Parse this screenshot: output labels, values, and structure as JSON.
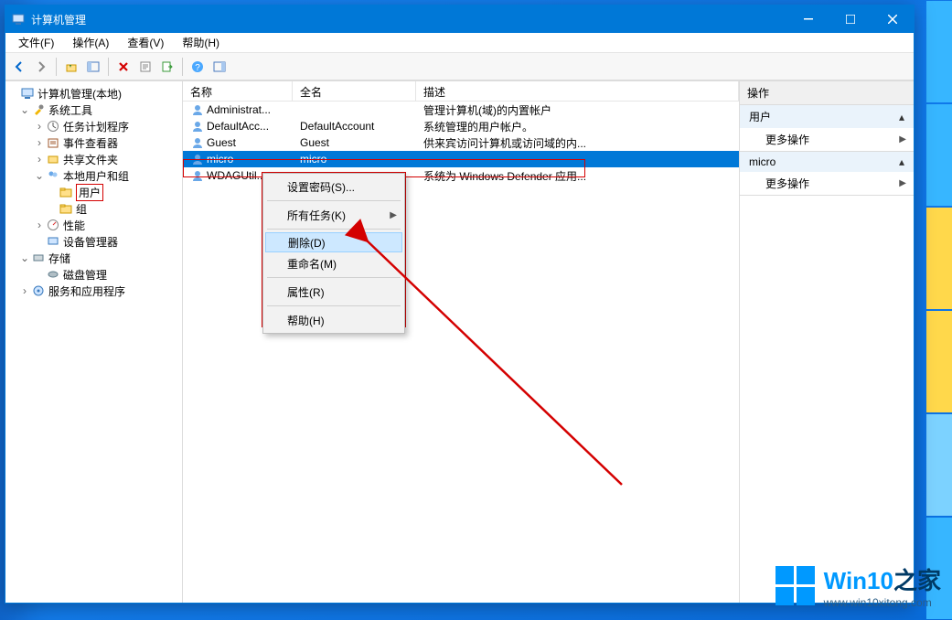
{
  "window": {
    "title": "计算机管理",
    "menus": [
      "文件(F)",
      "操作(A)",
      "查看(V)",
      "帮助(H)"
    ]
  },
  "tree": {
    "root": "计算机管理(本地)",
    "systools": "系统工具",
    "scheduler": "任务计划程序",
    "eventviewer": "事件查看器",
    "sharedfolders": "共享文件夹",
    "localusers": "本地用户和组",
    "users": "用户",
    "groups": "组",
    "performance": "性能",
    "devmgr": "设备管理器",
    "storage": "存储",
    "diskmgmt": "磁盘管理",
    "services": "服务和应用程序"
  },
  "columns": {
    "name": "名称",
    "fullname": "全名",
    "description": "描述"
  },
  "users": [
    {
      "name": "Administrat...",
      "fullname": "",
      "description": "管理计算机(域)的内置帐户"
    },
    {
      "name": "DefaultAcc...",
      "fullname": "DefaultAccount",
      "description": "系统管理的用户帐户。"
    },
    {
      "name": "Guest",
      "fullname": "Guest",
      "description": "供来宾访问计算机或访问域的内..."
    },
    {
      "name": "micro",
      "fullname": "micro",
      "description": "",
      "selected": true
    },
    {
      "name": "WDAGUtil...",
      "fullname": "",
      "description": "系统为 Windows Defender 应用..."
    }
  ],
  "context_menu": {
    "set_password": "设置密码(S)...",
    "all_tasks": "所有任务(K)",
    "delete": "删除(D)",
    "rename": "重命名(M)",
    "properties": "属性(R)",
    "help": "帮助(H)"
  },
  "actions": {
    "header": "操作",
    "group1": "用户",
    "group2": "micro",
    "more": "更多操作"
  },
  "watermark": {
    "brand_a": "Win10",
    "brand_b": "之家",
    "url": "www.win10xitong.com"
  }
}
